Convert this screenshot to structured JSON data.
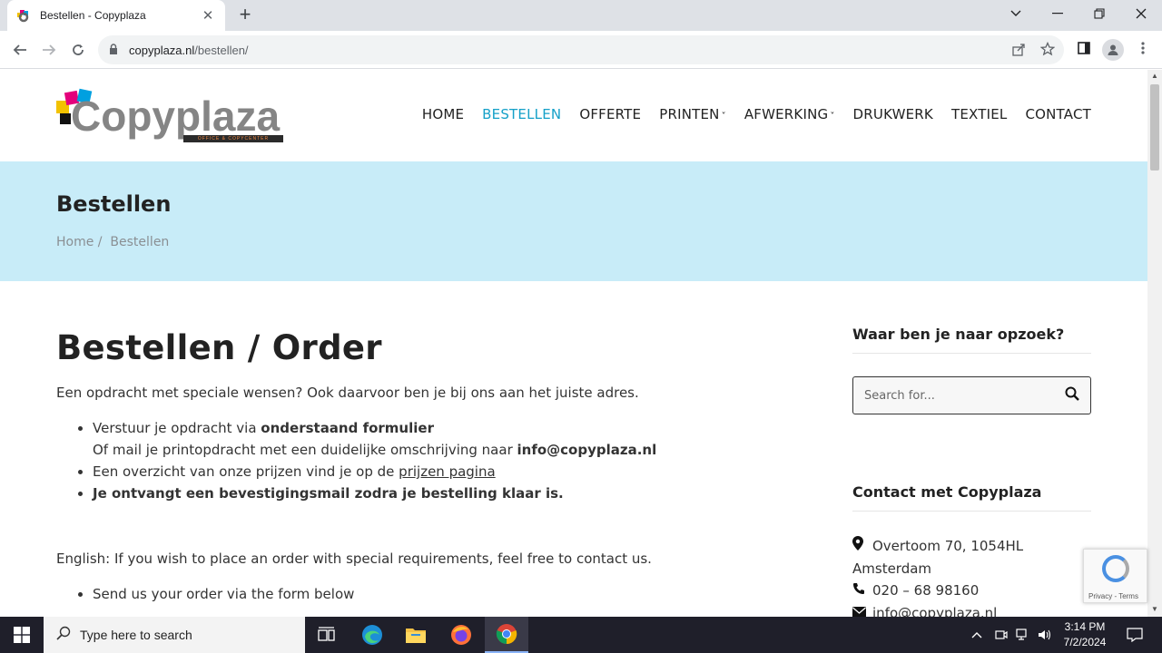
{
  "browser": {
    "tab_title": "Bestellen - Copyplaza",
    "tab_close": "✕",
    "new_tab": "+",
    "url_domain": "copyplaza.nl",
    "url_path": "/bestellen/"
  },
  "site": {
    "logo_text": "Copyplaza",
    "logo_sub": "OFFICE & COPYCENTER",
    "nav": [
      {
        "label": "HOME"
      },
      {
        "label": "BESTELLEN"
      },
      {
        "label": "OFFERTE"
      },
      {
        "label": "PRINTEN"
      },
      {
        "label": "AFWERKING"
      },
      {
        "label": "DRUKWERK"
      },
      {
        "label": "TEXTIEL"
      },
      {
        "label": "CONTACT"
      }
    ]
  },
  "hero": {
    "title": "Bestellen",
    "crumb_home": "Home",
    "crumb_sep": "/",
    "crumb_current": "Bestellen"
  },
  "content": {
    "heading": "Bestellen / Order",
    "intro": "Een opdracht met speciale wensen? Ook daarvoor ben je bij ons aan het juiste adres.",
    "li1_a": "Verstuur je opdracht via ",
    "li1_b": "onderstaand formulier",
    "li1_c": "Of mail je printopdracht met een duidelijke omschrijving naar ",
    "li1_d": "info@copyplaza.nl",
    "li2_a": "Een overzicht van onze prijzen vind je op de ",
    "li2_link": "prijzen pagina",
    "li3": "Je ontvangt een bevestigingsmail zodra je bestelling klaar is.",
    "english": "English: If you wish to place an order with special requirements, feel free to contact us.",
    "en_li1": "Send us  your order via the form below"
  },
  "sidebar": {
    "search_heading": "Waar ben je naar opzoek?",
    "search_placeholder": "Search for...",
    "contact_heading": "Contact met Copyplaza",
    "address": "Overtoom 70, 1054HL Amsterdam",
    "phone": "020 – 68 98160",
    "email": "info@copyplaza.nl"
  },
  "recaptcha": {
    "terms": "Privacy - Terms"
  },
  "taskbar": {
    "search_text": "Type here to search",
    "time": "3:14 PM",
    "date": "7/2/2024"
  },
  "colors": {
    "accent": "#15a0c8",
    "hero_bg": "#c8ecf8",
    "taskbar": "#1f1f2a"
  }
}
